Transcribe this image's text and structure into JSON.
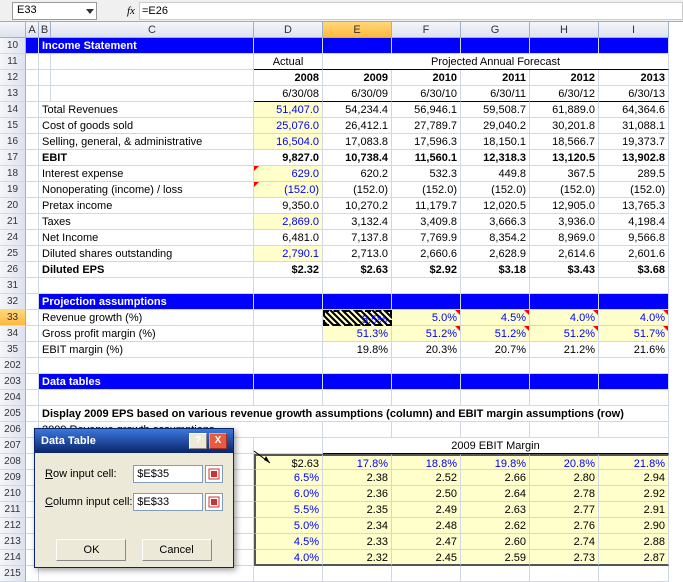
{
  "name_box": "E33",
  "fx_label": "fx",
  "formula": "=E26",
  "col_headers": {
    "a": "A",
    "b": "B",
    "c": "C",
    "d": "D",
    "e": "E",
    "f": "F",
    "g": "G",
    "h": "H",
    "i": "I"
  },
  "rows": [
    "10",
    "11",
    "12",
    "13",
    "14",
    "15",
    "16",
    "17",
    "18",
    "19",
    "20",
    "21",
    "24",
    "25",
    "26",
    "31",
    "32",
    "33",
    "34",
    "35",
    "202",
    "203",
    "204",
    "205",
    "206",
    "207",
    "208",
    "209",
    "210",
    "211",
    "212",
    "213",
    "214",
    "215"
  ],
  "income_statement": {
    "title": "Income Statement",
    "actual": "Actual",
    "forecast": "Projected Annual Forecast"
  },
  "years": {
    "y08": "2008",
    "y09": "2009",
    "y10": "2010",
    "y11": "2011",
    "y12": "2012",
    "y13": "2013"
  },
  "dates": {
    "d08": "6/30/08",
    "d09": "6/30/09",
    "d10": "6/30/10",
    "d11": "6/30/11",
    "d12": "6/30/12",
    "d13": "6/30/13"
  },
  "labels": {
    "total_rev": "Total Revenues",
    "cogs": "Cost of goods sold",
    "sga": "Selling, general, & administrative",
    "ebit": "EBIT",
    "int_exp": "Interest expense",
    "nonop": "Nonoperating (income) / loss",
    "pretax": "Pretax income",
    "taxes": "Taxes",
    "net_inc": "Net Income",
    "dil_shares": "Diluted shares outstanding",
    "dil_eps": "Diluted EPS",
    "proj_assump": "Projection assumptions",
    "rev_growth": "Revenue growth (%)",
    "gpm": "Gross profit margin (%)",
    "ebit_m": "EBIT margin (%)",
    "data_tables": "Data tables",
    "dt_desc": "Display 2009 EPS based on various revenue growth assumptions (column) and EBIT margin assumptions (row)",
    "dt_sub": "2009 Revenue  growth assumptions",
    "ebit_margin_hdr": "2009 EBIT Margin"
  },
  "vals": {
    "rev": [
      "51,407.0",
      "54,234.4",
      "56,946.1",
      "59,508.7",
      "61,889.0",
      "64,364.6"
    ],
    "cogs": [
      "25,076.0",
      "26,412.1",
      "27,789.7",
      "29,040.2",
      "30,201.8",
      "31,088.1"
    ],
    "sga": [
      "16,504.0",
      "17,083.8",
      "17,596.3",
      "18,150.1",
      "18,566.7",
      "19,373.7"
    ],
    "ebit": [
      "9,827.0",
      "10,738.4",
      "11,560.1",
      "12,318.3",
      "13,120.5",
      "13,902.8"
    ],
    "int": [
      "629.0",
      "620.2",
      "532.3",
      "449.8",
      "367.5",
      "289.5"
    ],
    "nonop": [
      "(152.0)",
      "(152.0)",
      "(152.0)",
      "(152.0)",
      "(152.0)",
      "(152.0)"
    ],
    "pretax": [
      "9,350.0",
      "10,270.2",
      "11,179.7",
      "12,020.5",
      "12,905.0",
      "13,765.3"
    ],
    "taxes": [
      "2,869.0",
      "3,132.4",
      "3,409.8",
      "3,666.3",
      "3,936.0",
      "4,198.4"
    ],
    "ni": [
      "6,481.0",
      "7,137.8",
      "7,769.9",
      "8,354.2",
      "8,969.0",
      "9,566.8"
    ],
    "dil": [
      "2,790.1",
      "2,713.0",
      "2,660.6",
      "2,628.9",
      "2,614.6",
      "2,601.6"
    ],
    "eps": [
      "$2.32",
      "$2.63",
      "$2.92",
      "$3.18",
      "$3.43",
      "$3.68"
    ],
    "growth": [
      "",
      "5.5%",
      "5.0%",
      "4.5%",
      "4.0%",
      "4.0%"
    ],
    "gpm": [
      "",
      "51.3%",
      "51.2%",
      "51.2%",
      "51.2%",
      "51.7%"
    ],
    "ebitm": [
      "",
      "19.8%",
      "20.3%",
      "20.7%",
      "21.2%",
      "21.6%"
    ]
  },
  "table": {
    "margin_cols": [
      "17.8%",
      "18.8%",
      "19.8%",
      "20.8%",
      "21.8%"
    ],
    "anchor": "$2.63",
    "rows": [
      {
        "g": "6.5%",
        "v": [
          "2.38",
          "2.52",
          "2.66",
          "2.80",
          "2.94"
        ]
      },
      {
        "g": "6.0%",
        "v": [
          "2.36",
          "2.50",
          "2.64",
          "2.78",
          "2.92"
        ]
      },
      {
        "g": "5.5%",
        "v": [
          "2.35",
          "2.49",
          "2.63",
          "2.77",
          "2.91"
        ]
      },
      {
        "g": "5.0%",
        "v": [
          "2.34",
          "2.48",
          "2.62",
          "2.76",
          "2.90"
        ]
      },
      {
        "g": "4.5%",
        "v": [
          "2.33",
          "2.47",
          "2.60",
          "2.74",
          "2.88"
        ]
      },
      {
        "g": "4.0%",
        "v": [
          "2.32",
          "2.45",
          "2.59",
          "2.73",
          "2.87"
        ]
      }
    ]
  },
  "dialog": {
    "title": "Data Table",
    "row_label": "Row input cell:",
    "col_label": "Column input cell:",
    "row_val": "$E$35",
    "col_val": "$E$33",
    "ok": "OK",
    "cancel": "Cancel",
    "help": "?",
    "close": "X",
    "row_u": "R",
    "col_u": "C"
  }
}
